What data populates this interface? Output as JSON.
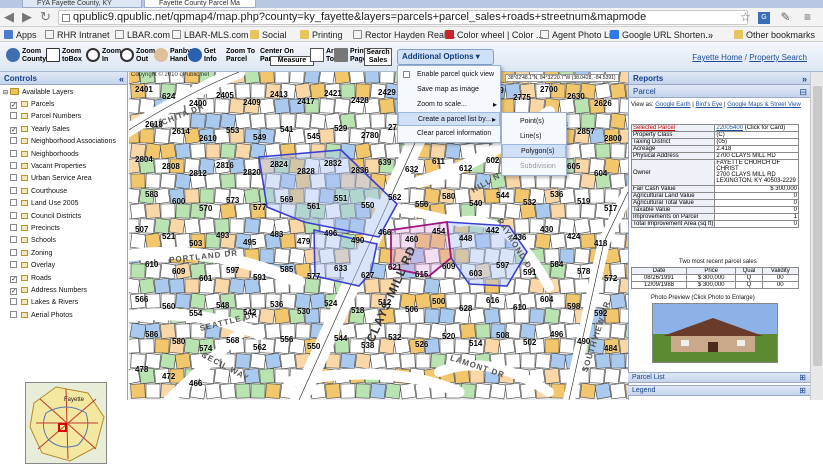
{
  "browser": {
    "tabs": [
      {
        "label": "FYA Fayette County, KY"
      },
      {
        "label": "Fayette County Parcel Ma"
      }
    ],
    "url": "qpublic9.qpublic.net/qpmap4/map.php?county=ky_fayette&layers=parcels+parcel_sales+roads+streetnum&mapmode",
    "bookmarks": [
      "Apps",
      "RHR Intranet",
      "LBAR.com",
      "LBAR-MLS.com",
      "Social",
      "Printing",
      "Rector Hayden Realt...",
      "Color wheel | Color ...",
      "Agent Photo List",
      "Google URL Shorten..."
    ],
    "other_bookmarks": "Other bookmarks",
    "overflow": "»",
    "icons": [
      "back-icon",
      "forward-icon",
      "reload-icon",
      "star-icon",
      "menu-icon"
    ]
  },
  "toolbar": {
    "buttons": [
      {
        "label": "Zoom County"
      },
      {
        "label": "Zoom toBox"
      },
      {
        "label": "Zoom In"
      },
      {
        "label": "Zoom Out"
      },
      {
        "label": "Panby Hand"
      },
      {
        "label": "Get Info"
      },
      {
        "label": "Zoom To Parcel"
      },
      {
        "label": "Center On Parcel"
      },
      {
        "label": "Measure"
      },
      {
        "label": "Area Tool"
      },
      {
        "label": "Print Page"
      },
      {
        "label": "Search Sales"
      }
    ],
    "additional_options": "Additional Options",
    "links": {
      "home": "Fayette Home",
      "search": "Property Search",
      "sep": " / "
    }
  },
  "menu": {
    "items": [
      {
        "label": "Enable parcel quick view"
      },
      {
        "label": "Save map as image"
      },
      {
        "label": "Zoom to scale..."
      },
      {
        "label": "Create a parcel list by..."
      },
      {
        "label": "Clear parcel information"
      }
    ],
    "submenu": [
      {
        "label": "Point(s)"
      },
      {
        "label": "Line(s)"
      },
      {
        "label": "Polygon(s)"
      },
      {
        "label": "Subdivision"
      }
    ]
  },
  "controls": {
    "title": "Controls",
    "root": "Available Layers",
    "layers": [
      {
        "label": "Parcels",
        "checked": true
      },
      {
        "label": "Parcel Numbers",
        "checked": false
      },
      {
        "label": "Yearly Sales",
        "checked": true
      },
      {
        "label": "Neighborhood Associations",
        "checked": false
      },
      {
        "label": "Neighborhoods",
        "checked": false
      },
      {
        "label": "Vacant Properties",
        "checked": false
      },
      {
        "label": "Urban Service Area",
        "checked": false
      },
      {
        "label": "Courthouse",
        "checked": false
      },
      {
        "label": "Land Use 2005",
        "checked": false
      },
      {
        "label": "Council Districts",
        "checked": false
      },
      {
        "label": "Precincts",
        "checked": false
      },
      {
        "label": "Schools",
        "checked": false
      },
      {
        "label": "Zoning",
        "checked": false
      },
      {
        "label": "Overlay",
        "checked": false
      },
      {
        "label": "Roads",
        "checked": true
      },
      {
        "label": "Address Numbers",
        "checked": true
      },
      {
        "label": "Lakes & Rivers",
        "checked": false
      },
      {
        "label": "Aerial Photos",
        "checked": false
      }
    ],
    "overview_label": "Fayette"
  },
  "map": {
    "copyright": "Copyright © 2010 qPublic.net",
    "coord": "38°02'48.1\"N, 84°32'20.7\"W (38.0428, -84.5391)",
    "streets": [
      "WICHITA DR",
      "HILL N DALE RD",
      "CLAYS MILL RD",
      "PORTLAND DR",
      "SEATTLE DR",
      "CECIL WAY",
      "RAYMOND DR",
      "SOUTHVIEW DR",
      "LAMONT DR"
    ],
    "parcel_numbers": [
      "2401",
      "624",
      "2400",
      "2405",
      "2409",
      "2413",
      "2417",
      "2421",
      "2428",
      "2429",
      "2424",
      "2787",
      "2783",
      "2779",
      "2775",
      "2700",
      "2630",
      "2626",
      "2618",
      "2614",
      "2610",
      "553",
      "549",
      "541",
      "545",
      "529",
      "2780",
      "2795",
      "2833",
      "2837",
      "2841",
      "2845",
      "2849",
      "2853",
      "2857",
      "2800",
      "2804",
      "2808",
      "2812",
      "2816",
      "2820",
      "2824",
      "2828",
      "2832",
      "2836",
      "639",
      "632",
      "611",
      "612",
      "602",
      "617",
      "615",
      "605",
      "604",
      "583",
      "600",
      "570",
      "573",
      "577",
      "569",
      "561",
      "551",
      "550",
      "562",
      "556",
      "580",
      "540",
      "544",
      "532",
      "536",
      "519",
      "517",
      "507",
      "521",
      "503",
      "493",
      "495",
      "483",
      "479",
      "496",
      "490",
      "466",
      "460",
      "454",
      "448",
      "442",
      "436",
      "430",
      "424",
      "418",
      "610",
      "609",
      "601",
      "597",
      "591",
      "585",
      "577",
      "633",
      "627",
      "621",
      "615",
      "609",
      "603",
      "597",
      "591",
      "584",
      "578",
      "572",
      "566",
      "560",
      "554",
      "548",
      "542",
      "536",
      "530",
      "524",
      "518",
      "512",
      "506",
      "500",
      "628",
      "616",
      "610",
      "604",
      "598",
      "592",
      "586",
      "580",
      "574",
      "568",
      "562",
      "556",
      "550",
      "544",
      "538",
      "532",
      "526",
      "520",
      "514",
      "508",
      "502",
      "496",
      "490",
      "484",
      "478",
      "472",
      "466"
    ]
  },
  "reports": {
    "title": "Reports",
    "section": "Parcel",
    "view_as": "View as:",
    "view_links": [
      "Google Earth",
      "Bird's Eye",
      "Google Maps & Street View"
    ],
    "selected_label": "Selected Parcel",
    "selected_value": "22005400",
    "click_card": "(Click for Card)",
    "rows": [
      {
        "label": "Property Class",
        "value": "(C)"
      },
      {
        "label": "Taxing District",
        "value": "(05)"
      },
      {
        "label": "Acreage",
        "value": "2.418"
      },
      {
        "label": "Physical Address",
        "value": "2700 CLAYS MILL RD"
      },
      {
        "label": "Owner",
        "value": "FAYETTE CHURCH OF CHRIST\n2700 CLAYS MILL RD\nLEXINGTON, KY 40503-2229"
      },
      {
        "label": "Fair Cash Value",
        "value": "$ 300,000"
      },
      {
        "label": "Agricultural Land Value",
        "value": "0"
      },
      {
        "label": "Agricultural Total Value",
        "value": "0"
      },
      {
        "label": "Taxable Value",
        "value": "0"
      },
      {
        "label": "Improvements on Parcel",
        "value": "1"
      },
      {
        "label": "Total Improvement Area (sq ft)",
        "value": "0"
      }
    ],
    "sales_title": "Two most recent parcel sales",
    "sales_headers": [
      "Date",
      "Price",
      "Qual",
      "Validity"
    ],
    "sales": [
      [
        "08/26/1991",
        "$ 300,000",
        "Q",
        "00"
      ],
      [
        "12/09/1988",
        "$ 300,000",
        "Q",
        "00"
      ]
    ],
    "photo_caption": "Photo Preview (Click Photo to Enlarge)",
    "parcel_list": "Parcel List",
    "legend": "Legend"
  }
}
